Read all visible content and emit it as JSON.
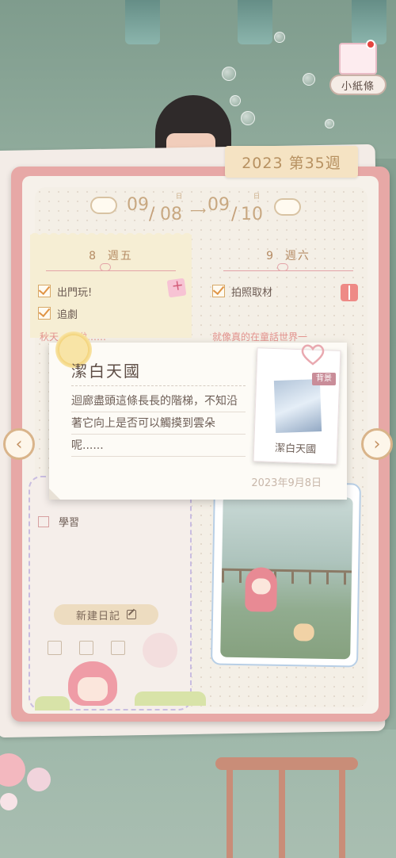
{
  "widget": {
    "label": "小紙條"
  },
  "diary": {
    "week_label": "2023 第35週",
    "date_range": {
      "start_month": "09",
      "start_day": "08",
      "end_month": "09",
      "end_day": "10",
      "day_marker": "日"
    },
    "days": [
      {
        "date": "8",
        "weekday": "週五",
        "tasks": [
          "出門玩!",
          "追劇"
        ],
        "note": "秋天…到啦……"
      },
      {
        "date": "9",
        "weekday": "週六",
        "tasks": [
          "拍照取材"
        ],
        "note": "就像真的在童話世界一"
      }
    ],
    "pending_tasks": [
      "學習"
    ],
    "new_diary_label": "新建日記"
  },
  "popup": {
    "title": "潔白天國",
    "body": "迴廊盡頭這條長長的階梯，不知沿著它向上是否可以觸摸到雲朵呢......",
    "date": "2023年9月8日",
    "item_name": "潔白天國",
    "item_badge": "背景"
  },
  "colors": {
    "accent_pink": "#e7a8a6",
    "check_orange": "#e09445",
    "week_tab": "#f5e3c3",
    "text": "#6b5a52"
  }
}
